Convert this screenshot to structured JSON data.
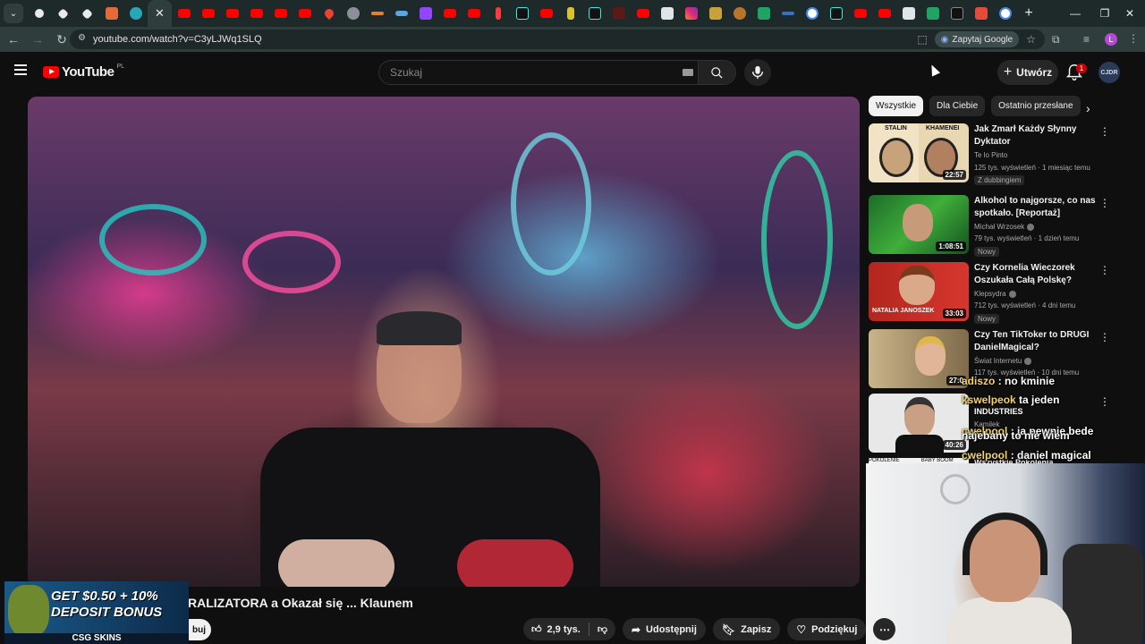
{
  "browser": {
    "url": "youtube.com/watch?v=C3yLJWq1SLQ",
    "ask_google": "Zapytaj Google",
    "profile_initial": "L"
  },
  "youtube": {
    "logo": "YouTube",
    "country": "PL",
    "search_placeholder": "Szukaj",
    "create_label": "Utwórz",
    "notification_count": "1",
    "avatar_text": "CJDR"
  },
  "chips": [
    "Wszystkie",
    "Dla Ciebie",
    "Ostatnio przesłane"
  ],
  "recommendations": [
    {
      "title": "Jak Zmarł Każdy Słynny Dyktator",
      "channel": "Te lo Pinto",
      "meta": "125 tys. wyświetleń · 1 miesiąc temu",
      "badge": "Z dubbingiem",
      "duration": "22:57"
    },
    {
      "title": "Alkohol to najgorsze, co nas spotkało. [Reportaż]",
      "channel": "Michał Wrzosek",
      "meta": "79 tys. wyświetleń · 1 dzień temu",
      "badge": "Nowy",
      "duration": "1:08:51"
    },
    {
      "title": "Czy Kornelia Wieczorek Oszukała Całą Polskę?",
      "channel": "Klepsydra",
      "meta": "712 tys. wyświetleń · 4 dni temu",
      "badge": "Nowy",
      "duration": "33:03"
    },
    {
      "title": "Czy Ten TikToker to DRUGI DanielMagical?",
      "channel": "Świat Internetu",
      "meta": "117 tys. wyświetleń · 10 dni temu",
      "badge": "",
      "duration": "27:0"
    },
    {
      "title": "",
      "channel": "Kamilek",
      "meta": "",
      "badge": "",
      "duration": "40:26"
    }
  ],
  "thumb_texts": {
    "stalin": "STALIN",
    "khamenei": "KHAMENEI",
    "natalia": "NATALIA JANOSZEK",
    "industries": "INDUSTRIES",
    "pokolenie": "POKOLENIE",
    "baby_boom": "BABY BOOM",
    "wszystkie": "Wszystkie Pokolenia"
  },
  "chat": [
    {
      "user": "adiszo",
      "msg": ": no kminie"
    },
    {
      "user": "kswelpeok",
      "msg": "ta jeden"
    },
    {
      "user": "cwelpool",
      "msg": ": ja pewnie bede"
    },
    {
      "user": "",
      "msg": "najebany to nie wiem"
    },
    {
      "user": "cwelpool",
      "msg": ": daniel magical"
    }
  ],
  "video": {
    "title": "RALIZATORA a Okazał się ... Klaunem",
    "subscribe_stub": "buj"
  },
  "actions": {
    "likes": "2,9 tys.",
    "share": "Udostępnij",
    "save": "Zapisz",
    "thanks": "Podziękuj"
  },
  "promo": {
    "line1": "GET $0.50 + 10%",
    "line2": "DEPOSIT BONUS",
    "brand": "CSG SKINS"
  },
  "colors": {
    "bg": "#0f0f0f",
    "chrome_bg": "#1e2a2a",
    "yt_red": "#ff0000",
    "chip_selected": "#f1f1f1"
  }
}
